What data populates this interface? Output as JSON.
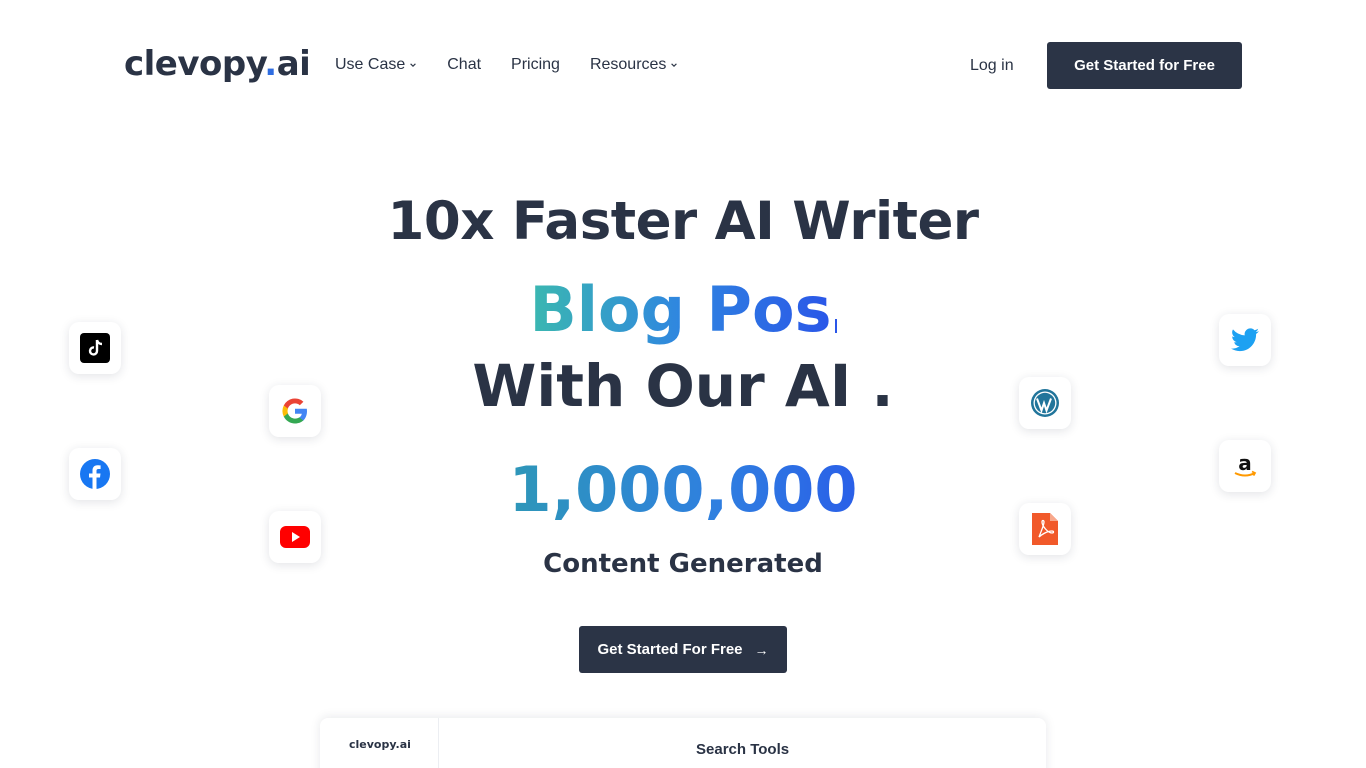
{
  "header": {
    "logo_main": "clevopy",
    "logo_dot": ".",
    "logo_suffix": "ai",
    "nav": [
      {
        "label": "Use Case",
        "has_dropdown": true
      },
      {
        "label": "Chat",
        "has_dropdown": false
      },
      {
        "label": "Pricing",
        "has_dropdown": false
      },
      {
        "label": "Resources",
        "has_dropdown": true
      }
    ],
    "login_label": "Log in",
    "cta_label": "Get Started for Free"
  },
  "hero": {
    "title": "10x Faster AI Writer",
    "typing_text": "Blog Pos",
    "subtitle": "With Our AI .",
    "counter_value": "1,000,000",
    "counter_label": "Content Generated",
    "cta_label": "Get Started For Free",
    "cta_icon": "arrow-right-icon"
  },
  "floating_icons": [
    "tiktok-icon",
    "google-icon",
    "facebook-icon",
    "youtube-icon",
    "twitter-icon",
    "wordpress-icon",
    "amazon-icon",
    "pdf-icon"
  ],
  "preview": {
    "logo": "clevopy.ai",
    "title": "Search Tools"
  },
  "colors": {
    "dark": "#2b3446",
    "accent": "#2f6de1",
    "gradient_start": "#3bb8b0",
    "gradient_end": "#2a56e8"
  }
}
